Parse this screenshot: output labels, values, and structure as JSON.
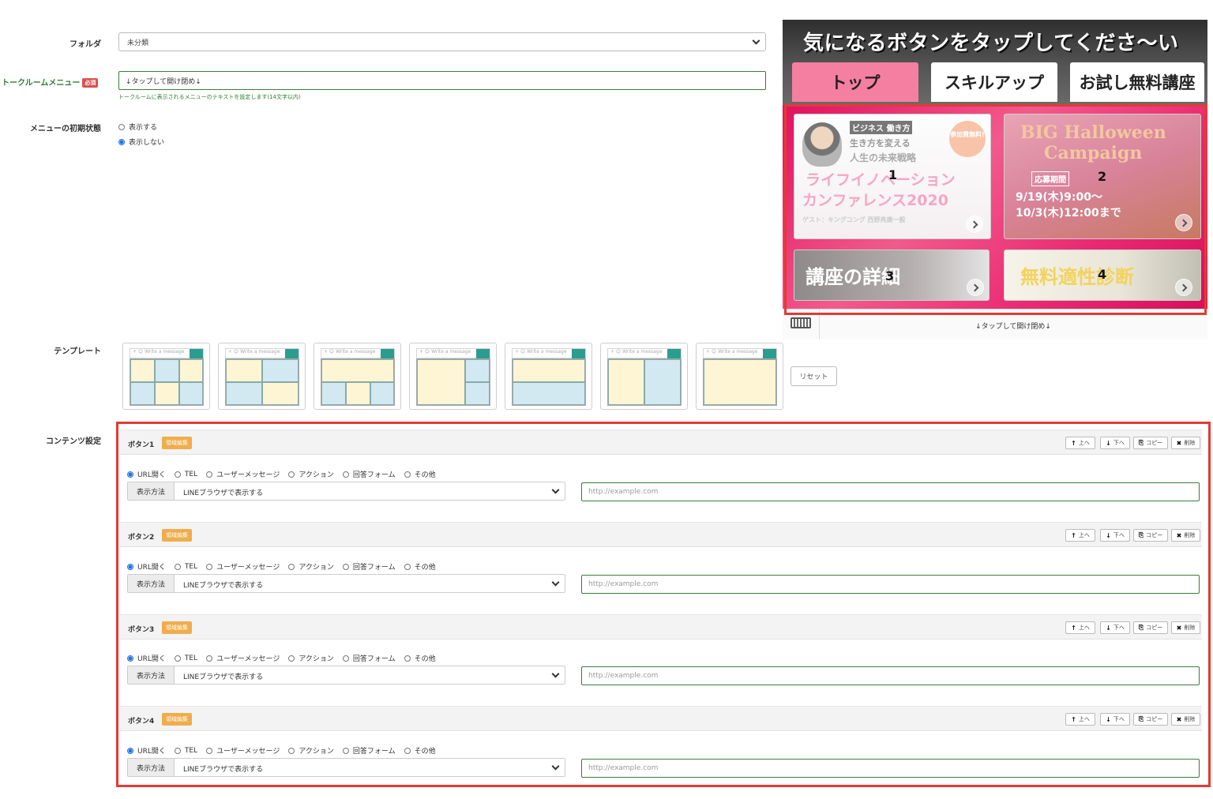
{
  "folder": {
    "label": "フォルダ",
    "value": "未分類"
  },
  "talk_menu": {
    "label": "トークルームメニュー",
    "required_badge": "必須",
    "value": "↓タップして開け閉め↓",
    "hint": "トークルームに表示されるメニューのテキストを設定します(14文字以内)"
  },
  "initial_state": {
    "label": "メニューの初期状態",
    "options": [
      "表示する",
      "表示しない"
    ],
    "selected": "表示しない"
  },
  "preview": {
    "title": "気になるボタンをタップしてくださ〜い",
    "tabs": [
      "トップ",
      "スキルアップ",
      "お試し無料講座"
    ],
    "active_tab": "トップ",
    "tiles": [
      {
        "number": "1",
        "lines": [
          "ビジネス 働き方",
          "生き方を変える",
          "人生の未来戦略",
          "ライフイノベーション",
          "カンファレンス2020",
          "ゲスト：キングコング 西野亮廣一般"
        ],
        "badge": "参加費無料!"
      },
      {
        "number": "2",
        "lines": [
          "BIG Halloween",
          "Campaign",
          "応募期間",
          "9/19(木)9:00〜",
          "10/3(木)12:00まで"
        ]
      },
      {
        "number": "3",
        "lines": [
          "講座の詳細"
        ]
      },
      {
        "number": "4",
        "lines": [
          "無料適性診断"
        ]
      }
    ],
    "bottom_label": "↓タップして開け閉め↓",
    "colors": {
      "active_tab": "#f57fa0",
      "panel": "#ea2b73",
      "highlight": "#e53935"
    }
  },
  "templates": {
    "label": "テンプレート",
    "bar_text": "+ ☺ Write a message",
    "reset_label": "リセット"
  },
  "content_settings": {
    "label": "コンテンツ設定",
    "edit_badge": "領域編集",
    "controls": {
      "up": "上へ",
      "down": "下へ",
      "copy": "コピー",
      "delete": "削除"
    },
    "action_options": [
      "URL開く",
      "TEL",
      "ユーザーメッセージ",
      "アクション",
      "回答フォーム",
      "その他"
    ],
    "method_label": "表示方法",
    "buttons": [
      {
        "title": "ボタン1",
        "selected_action": "URL開く",
        "method_value": "LINEブラウザで表示する",
        "url_placeholder": "http://example.com"
      },
      {
        "title": "ボタン2",
        "selected_action": "URL開く",
        "method_value": "LINEブラウザで表示する",
        "url_placeholder": "http://example.com"
      },
      {
        "title": "ボタン3",
        "selected_action": "URL開く",
        "method_value": "LINEブラウザで表示する",
        "url_placeholder": "http://example.com"
      },
      {
        "title": "ボタン4",
        "selected_action": "URL開く",
        "method_value": "LINEブラウザで表示する",
        "url_placeholder": "http://example.com"
      }
    ]
  }
}
